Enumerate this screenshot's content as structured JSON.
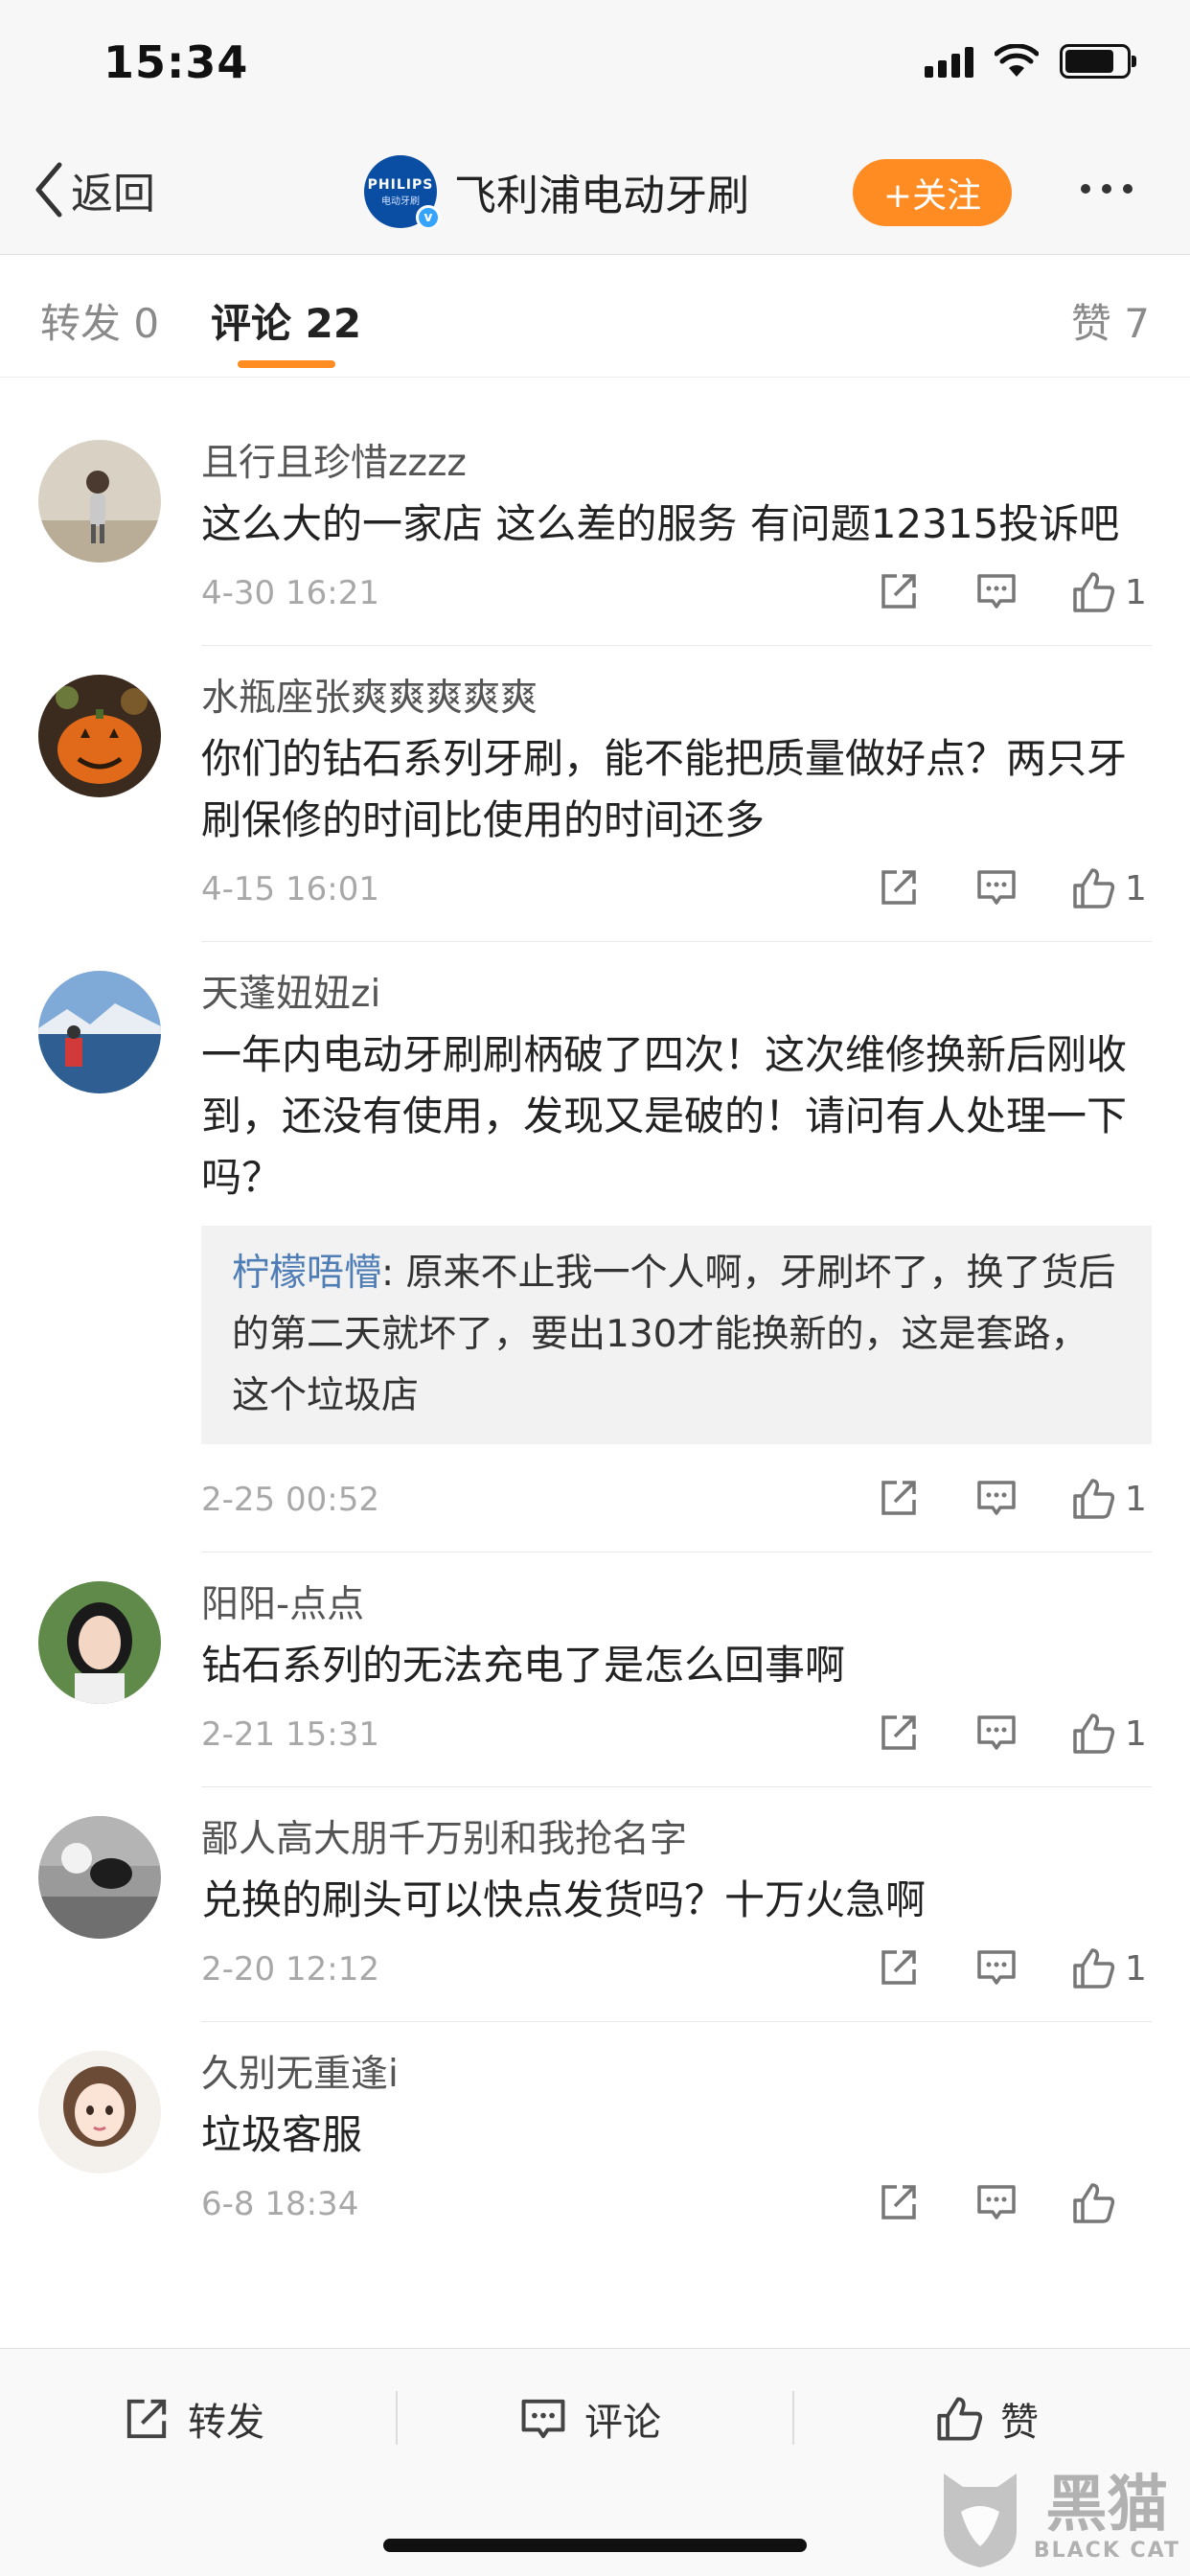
{
  "status_bar": {
    "time": "15:34"
  },
  "nav": {
    "back_label": "返回",
    "title": "飞利浦电动牙刷",
    "logo_text": "PHILIPS",
    "logo_subtext": "电动牙刷",
    "follow_label": "+关注"
  },
  "tabs": {
    "repost": "转发 0",
    "comment": "评论 22",
    "like": "赞 7"
  },
  "comments": [
    {
      "user": "且行且珍惜zzzz",
      "text": "这么大的一家店 这么差的服务  有问题12315投诉吧",
      "date": "4-30 16:21",
      "likes": "1"
    },
    {
      "user": "水瓶座张爽爽爽爽爽",
      "text": "你们的钻石系列牙刷，能不能把质量做好点？两只牙刷保修的时间比使用的时间还多",
      "date": "4-15 16:01",
      "likes": "1"
    },
    {
      "user": "天蓬妞妞zi",
      "text": "一年内电动牙刷刷柄破了四次！这次维修换新后刚收到，还没有使用，发现又是破的！请问有人处理一下吗？",
      "reply_user": "柠檬唔懵",
      "reply_text": ": 原来不止我一个人啊，牙刷坏了，换了货后的第二天就坏了，要出130才能换新的，这是套路，这个垃圾店",
      "date": "2-25 00:52",
      "likes": "1"
    },
    {
      "user": "阳阳-点点",
      "text": "钻石系列的无法充电了是怎么回事啊",
      "date": "2-21 15:31",
      "likes": "1"
    },
    {
      "user": "鄙人高大朋千万别和我抢名字",
      "text": "兑换的刷头可以快点发货吗？十万火急啊",
      "date": "2-20 12:12",
      "likes": "1"
    },
    {
      "user": "久别无重逢i",
      "text": "垃圾客服",
      "date": "6-8 18:34",
      "likes": ""
    }
  ],
  "bottom_bar": {
    "repost": "转发",
    "comment": "评论",
    "like": "赞"
  },
  "watermark": {
    "main": "黑猫",
    "sub": "BLACK CAT"
  },
  "colors": {
    "accent": "#ff8c23",
    "link": "#4f7db5",
    "verified": "#35a4ff"
  }
}
